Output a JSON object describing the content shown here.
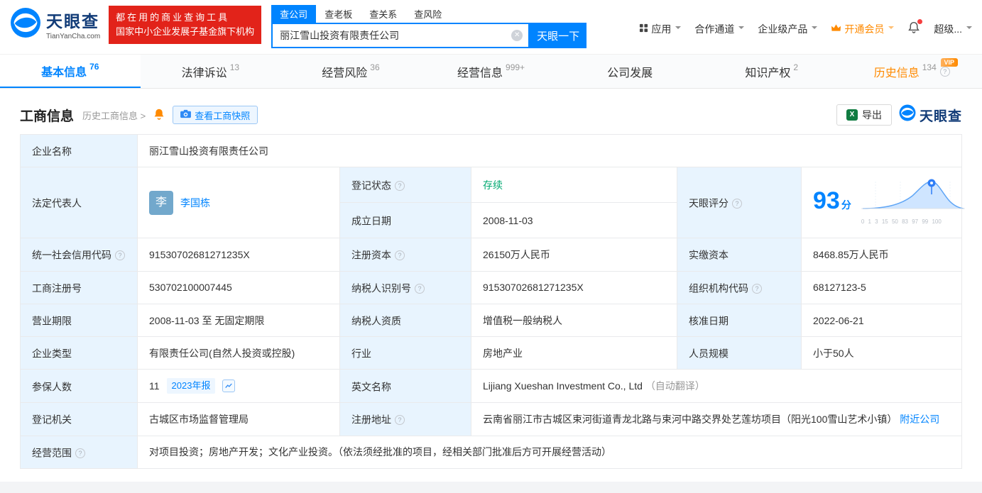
{
  "header": {
    "logo_cn": "天眼查",
    "logo_en": "TianYanCha.com",
    "promo_line1": "都在用的商业查询工具",
    "promo_line2": "国家中小企业发展子基金旗下机构",
    "search_tabs": [
      {
        "label": "查公司"
      },
      {
        "label": "查老板"
      },
      {
        "label": "查关系"
      },
      {
        "label": "查风险"
      }
    ],
    "search_value": "丽江雪山投资有限责任公司",
    "search_button": "天眼一下",
    "nav": [
      {
        "label": "应用"
      },
      {
        "label": "合作通道"
      },
      {
        "label": "企业级产品"
      },
      {
        "label": "开通会员"
      },
      {
        "label": "超级..."
      }
    ]
  },
  "tabs": [
    {
      "label": "基本信息",
      "count": "76"
    },
    {
      "label": "法律诉讼",
      "count": "13"
    },
    {
      "label": "经营风险",
      "count": "36"
    },
    {
      "label": "经营信息",
      "count": "999+"
    },
    {
      "label": "公司发展",
      "count": ""
    },
    {
      "label": "知识产权",
      "count": "2"
    },
    {
      "label": "历史信息",
      "count": "134",
      "vip": "VIP"
    }
  ],
  "section": {
    "title": "工商信息",
    "history_link": "历史工商信息 >",
    "snapshot_button": "查看工商快照",
    "export_button": "导出",
    "brand": "天眼查"
  },
  "company": {
    "name_label": "企业名称",
    "name": "丽江雪山投资有限责任公司",
    "legal_rep_label": "法定代表人",
    "legal_rep_avatar": "李",
    "legal_rep": "李国栋",
    "status_label": "登记状态",
    "status": "存续",
    "score_label": "天眼评分",
    "score": "93",
    "score_unit": "分",
    "score_axis": "0 1 3 15 50 83 97 99 100",
    "established_label": "成立日期",
    "established": "2008-11-03",
    "credit_code_label": "统一社会信用代码",
    "credit_code": "91530702681271235X",
    "reg_capital_label": "注册资本",
    "reg_capital": "26150万人民币",
    "paid_capital_label": "实缴资本",
    "paid_capital": "8468.85万人民币",
    "reg_no_label": "工商注册号",
    "reg_no": "530702100007445",
    "tax_id_label": "纳税人识别号",
    "tax_id": "91530702681271235X",
    "org_code_label": "组织机构代码",
    "org_code": "68127123-5",
    "term_label": "营业期限",
    "term": "2008-11-03 至 无固定期限",
    "tax_quality_label": "纳税人资质",
    "tax_quality": "增值税一般纳税人",
    "approved_label": "核准日期",
    "approved": "2022-06-21",
    "type_label": "企业类型",
    "type": "有限责任公司(自然人投资或控股)",
    "industry_label": "行业",
    "industry": "房地产业",
    "staff_label": "人员规模",
    "staff": "小于50人",
    "insured_label": "参保人数",
    "insured": "11",
    "annual_report": "2023年报",
    "en_name_label": "英文名称",
    "en_name": "Lijiang Xueshan Investment Co., Ltd",
    "en_name_note": "（自动翻译）",
    "registry_label": "登记机关",
    "registry": "古城区市场监督管理局",
    "address_label": "注册地址",
    "address": "云南省丽江市古城区束河街道青龙北路与束河中路交界处艺莲坊项目（阳光100雪山艺术小镇）",
    "nearby": "附近公司",
    "scope_label": "经营范围",
    "scope": "对项目投资；房地产开发；文化产业投资。（依法须经批准的项目，经相关部门批准后方可开展经营活动）"
  },
  "colors": {
    "accent": "#0084ff",
    "label_bg": "#e8f4fe",
    "status_green": "#00a870",
    "vip_orange": "#ff8a00",
    "promo_red": "#e2231a"
  }
}
